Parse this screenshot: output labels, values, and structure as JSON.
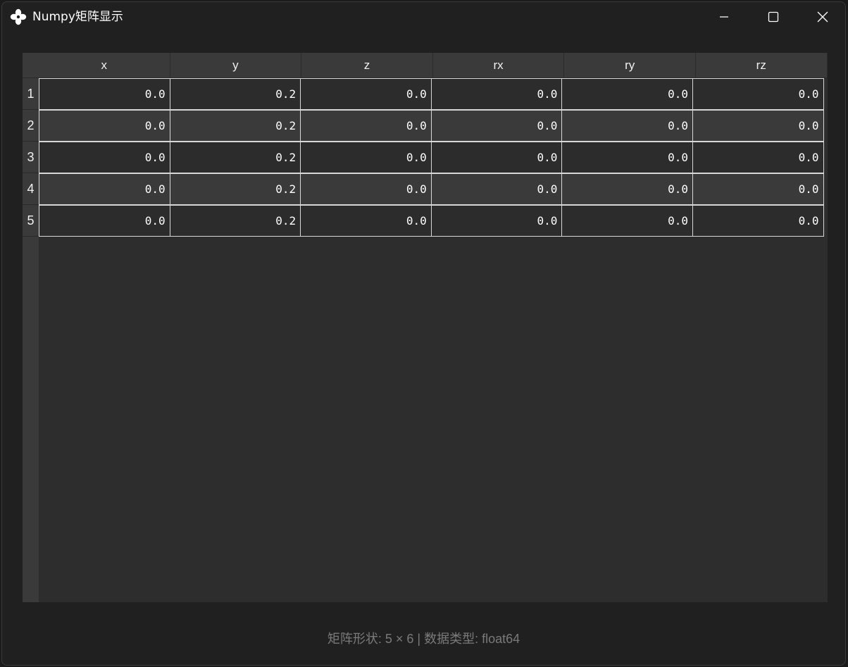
{
  "window": {
    "title": "Numpy矩阵显示",
    "icon": "pinwheel-icon",
    "controls": [
      "minimize-icon",
      "maximize-icon",
      "close-icon"
    ]
  },
  "table": {
    "columns": [
      "x",
      "y",
      "z",
      "rx",
      "ry",
      "rz"
    ],
    "row_labels": [
      "1",
      "2",
      "3",
      "4",
      "5"
    ],
    "rows": [
      [
        "0.0",
        "0.2",
        "0.0",
        "0.0",
        "0.0",
        "0.0"
      ],
      [
        "0.0",
        "0.2",
        "0.0",
        "0.0",
        "0.0",
        "0.0"
      ],
      [
        "0.0",
        "0.2",
        "0.0",
        "0.0",
        "0.0",
        "0.0"
      ],
      [
        "0.0",
        "0.2",
        "0.0",
        "0.0",
        "0.0",
        "0.0"
      ],
      [
        "0.0",
        "0.2",
        "0.0",
        "0.0",
        "0.0",
        "0.0"
      ]
    ]
  },
  "status_bar": {
    "text": "矩阵形状: 5 × 6 | 数据类型: float64"
  },
  "colors": {
    "background": "#202020",
    "table_bg": "#2d2d2d",
    "header_bg": "#3a3a3a",
    "cell_border": "#d8d8d8"
  }
}
